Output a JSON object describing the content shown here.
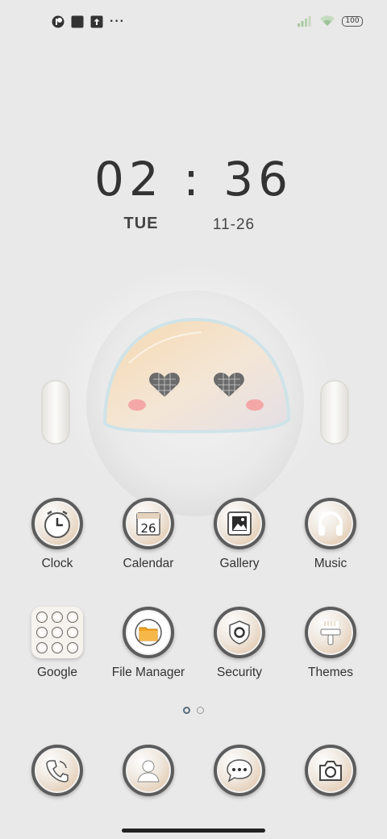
{
  "status_bar": {
    "battery_level": "100",
    "icons": [
      "status-app-icon",
      "square-icon",
      "upload-icon",
      "more-dots-icon",
      "signal-icon",
      "wifi-icon",
      "battery-icon"
    ],
    "more": "···"
  },
  "clock_widget": {
    "time": "02 : 36",
    "day": "TUE",
    "date": "11-26"
  },
  "apps": [
    {
      "label": "Clock",
      "icon": "clock-icon"
    },
    {
      "label": "Calendar",
      "icon": "calendar-icon",
      "badge": "26"
    },
    {
      "label": "Gallery",
      "icon": "gallery-icon"
    },
    {
      "label": "Music",
      "icon": "headphones-icon"
    },
    {
      "label": "Google",
      "icon": "folder-icon"
    },
    {
      "label": "File Manager",
      "icon": "folder-file-icon"
    },
    {
      "label": "Security",
      "icon": "shield-icon"
    },
    {
      "label": "Themes",
      "icon": "brush-icon"
    }
  ],
  "dock": [
    {
      "icon": "phone-icon"
    },
    {
      "icon": "contacts-icon"
    },
    {
      "icon": "messages-icon"
    },
    {
      "icon": "camera-icon"
    }
  ],
  "pager": {
    "pages": 2,
    "active": 1
  },
  "colors": {
    "background": "#e9e9e9",
    "icon_ring": "#5c5c5c",
    "blush": "#f4a7a7",
    "visor": "#f3d3a8"
  }
}
